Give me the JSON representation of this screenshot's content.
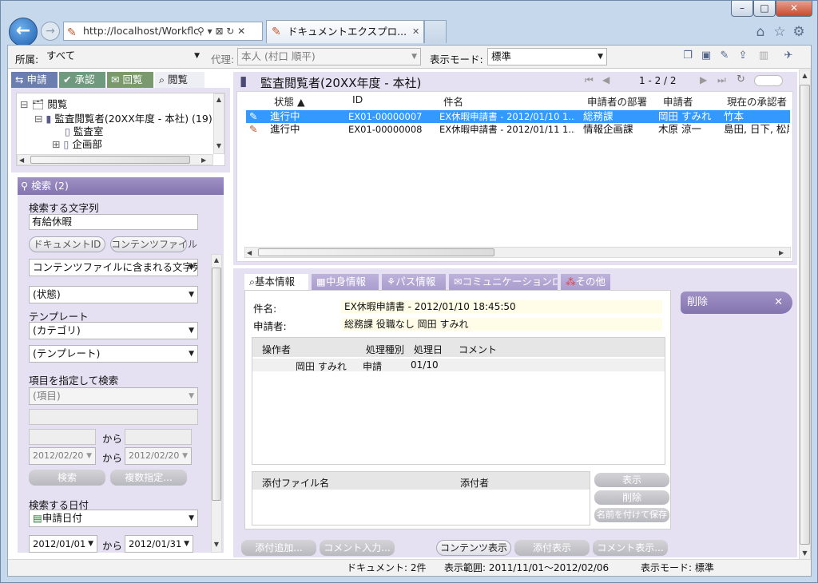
{
  "window": {
    "minimize": "–",
    "maximize": "□",
    "close": "✕"
  },
  "browser": {
    "url": "http://localhost/Workflc",
    "address_icons": "⚲ ▾ ⊠ ↻ ✕",
    "tab_title": "ドキュメントエクスプロ...",
    "tab_close": "✕",
    "icons": [
      "home-icon",
      "star-icon",
      "gear-icon"
    ]
  },
  "toolbar": {
    "affiliation_label": "所属:",
    "affiliation_value": "すべて",
    "proxy_label": "代理:",
    "proxy_value": "本人 (村口 順平)",
    "display_mode_label": "表示モード:",
    "display_mode_value": "標準"
  },
  "left_tabs": [
    "申請",
    "承認",
    "回覧",
    "閲覧"
  ],
  "tree": {
    "root": "閲覧",
    "child": "監査閲覧者(20XX年度 - 本社) (19)",
    "items": [
      "監査室",
      "企画部"
    ]
  },
  "search": {
    "header": "検索",
    "count": "(2)",
    "text_label": "検索する文字列",
    "text_value": "有給休暇",
    "document_id_button": "ドキュメントID",
    "content_file_button": "コンテンツファイル",
    "search_target": "コンテンツファイルに含まれる文字列",
    "status_select": "(状態)",
    "template_label": "テンプレート",
    "category_select": "(カテゴリ)",
    "template_select": "(テンプレート)",
    "item_search_label": "項目を指定して検索",
    "item_select": "(項目)",
    "from_label": "から",
    "date_from_1": "2012/02/20",
    "date_to_1": "2012/02/20",
    "search_button": "検索",
    "multi_button": "複数指定...",
    "date_label": "検索する日付",
    "date_type": "申請日付",
    "date_from_2": "2012/01/01",
    "date_to_2": "2012/01/31"
  },
  "list": {
    "title": "監査閲覧者(20XX年度 - 本社)",
    "pagination": "1 - 2 / 2",
    "columns": [
      "状態 ▲",
      "ID",
      "件名",
      "申請者の部署",
      "申請者",
      "現在の承認者"
    ],
    "rows": [
      {
        "status": "進行中",
        "id": "EX01-00000007",
        "subject": "EX休暇申請書 - 2012/01/10 1...",
        "dept": "総務課",
        "applicant": "岡田 すみれ",
        "approver": "竹本",
        "selected": true
      },
      {
        "status": "進行中",
        "id": "EX01-00000008",
        "subject": "EX休暇申請書 - 2012/01/11 1...",
        "dept": "情報企画課",
        "applicant": "木原 涼一",
        "approver": "島田, 日下, 松尾",
        "selected": false
      }
    ]
  },
  "detail": {
    "tabs": [
      "基本情報",
      "中身情報",
      "パス情報",
      "コミュニケーションログ",
      "その他"
    ],
    "subject_label": "件名:",
    "subject_value": "EX休暇申請書 - 2012/01/10 18:45:50",
    "applicant_label": "申請者:",
    "applicant_value": "総務課 役職なし 岡田 すみれ",
    "history_columns": [
      "操作者",
      "処理種別",
      "処理日",
      "コメント"
    ],
    "history_rows": [
      {
        "operator": "岡田 すみれ",
        "type": "申請",
        "date": "01/10",
        "comment": ""
      }
    ],
    "attach_columns": [
      "添付ファイル名",
      "添付者"
    ],
    "attach_buttons": [
      "表示",
      "削除",
      "名前を付けて保存"
    ],
    "bottom_buttons": [
      "添付追加...",
      "コメント入力...",
      "コンテンツ表示",
      "添付表示",
      "コメント表示..."
    ],
    "delete_label": "削除",
    "delete_x": "✕"
  },
  "status_bar": {
    "documents": "ドキュメント: 2件",
    "range": "表示範囲: 2011/11/01～2012/02/06",
    "mode": "表示モード: 標準"
  }
}
